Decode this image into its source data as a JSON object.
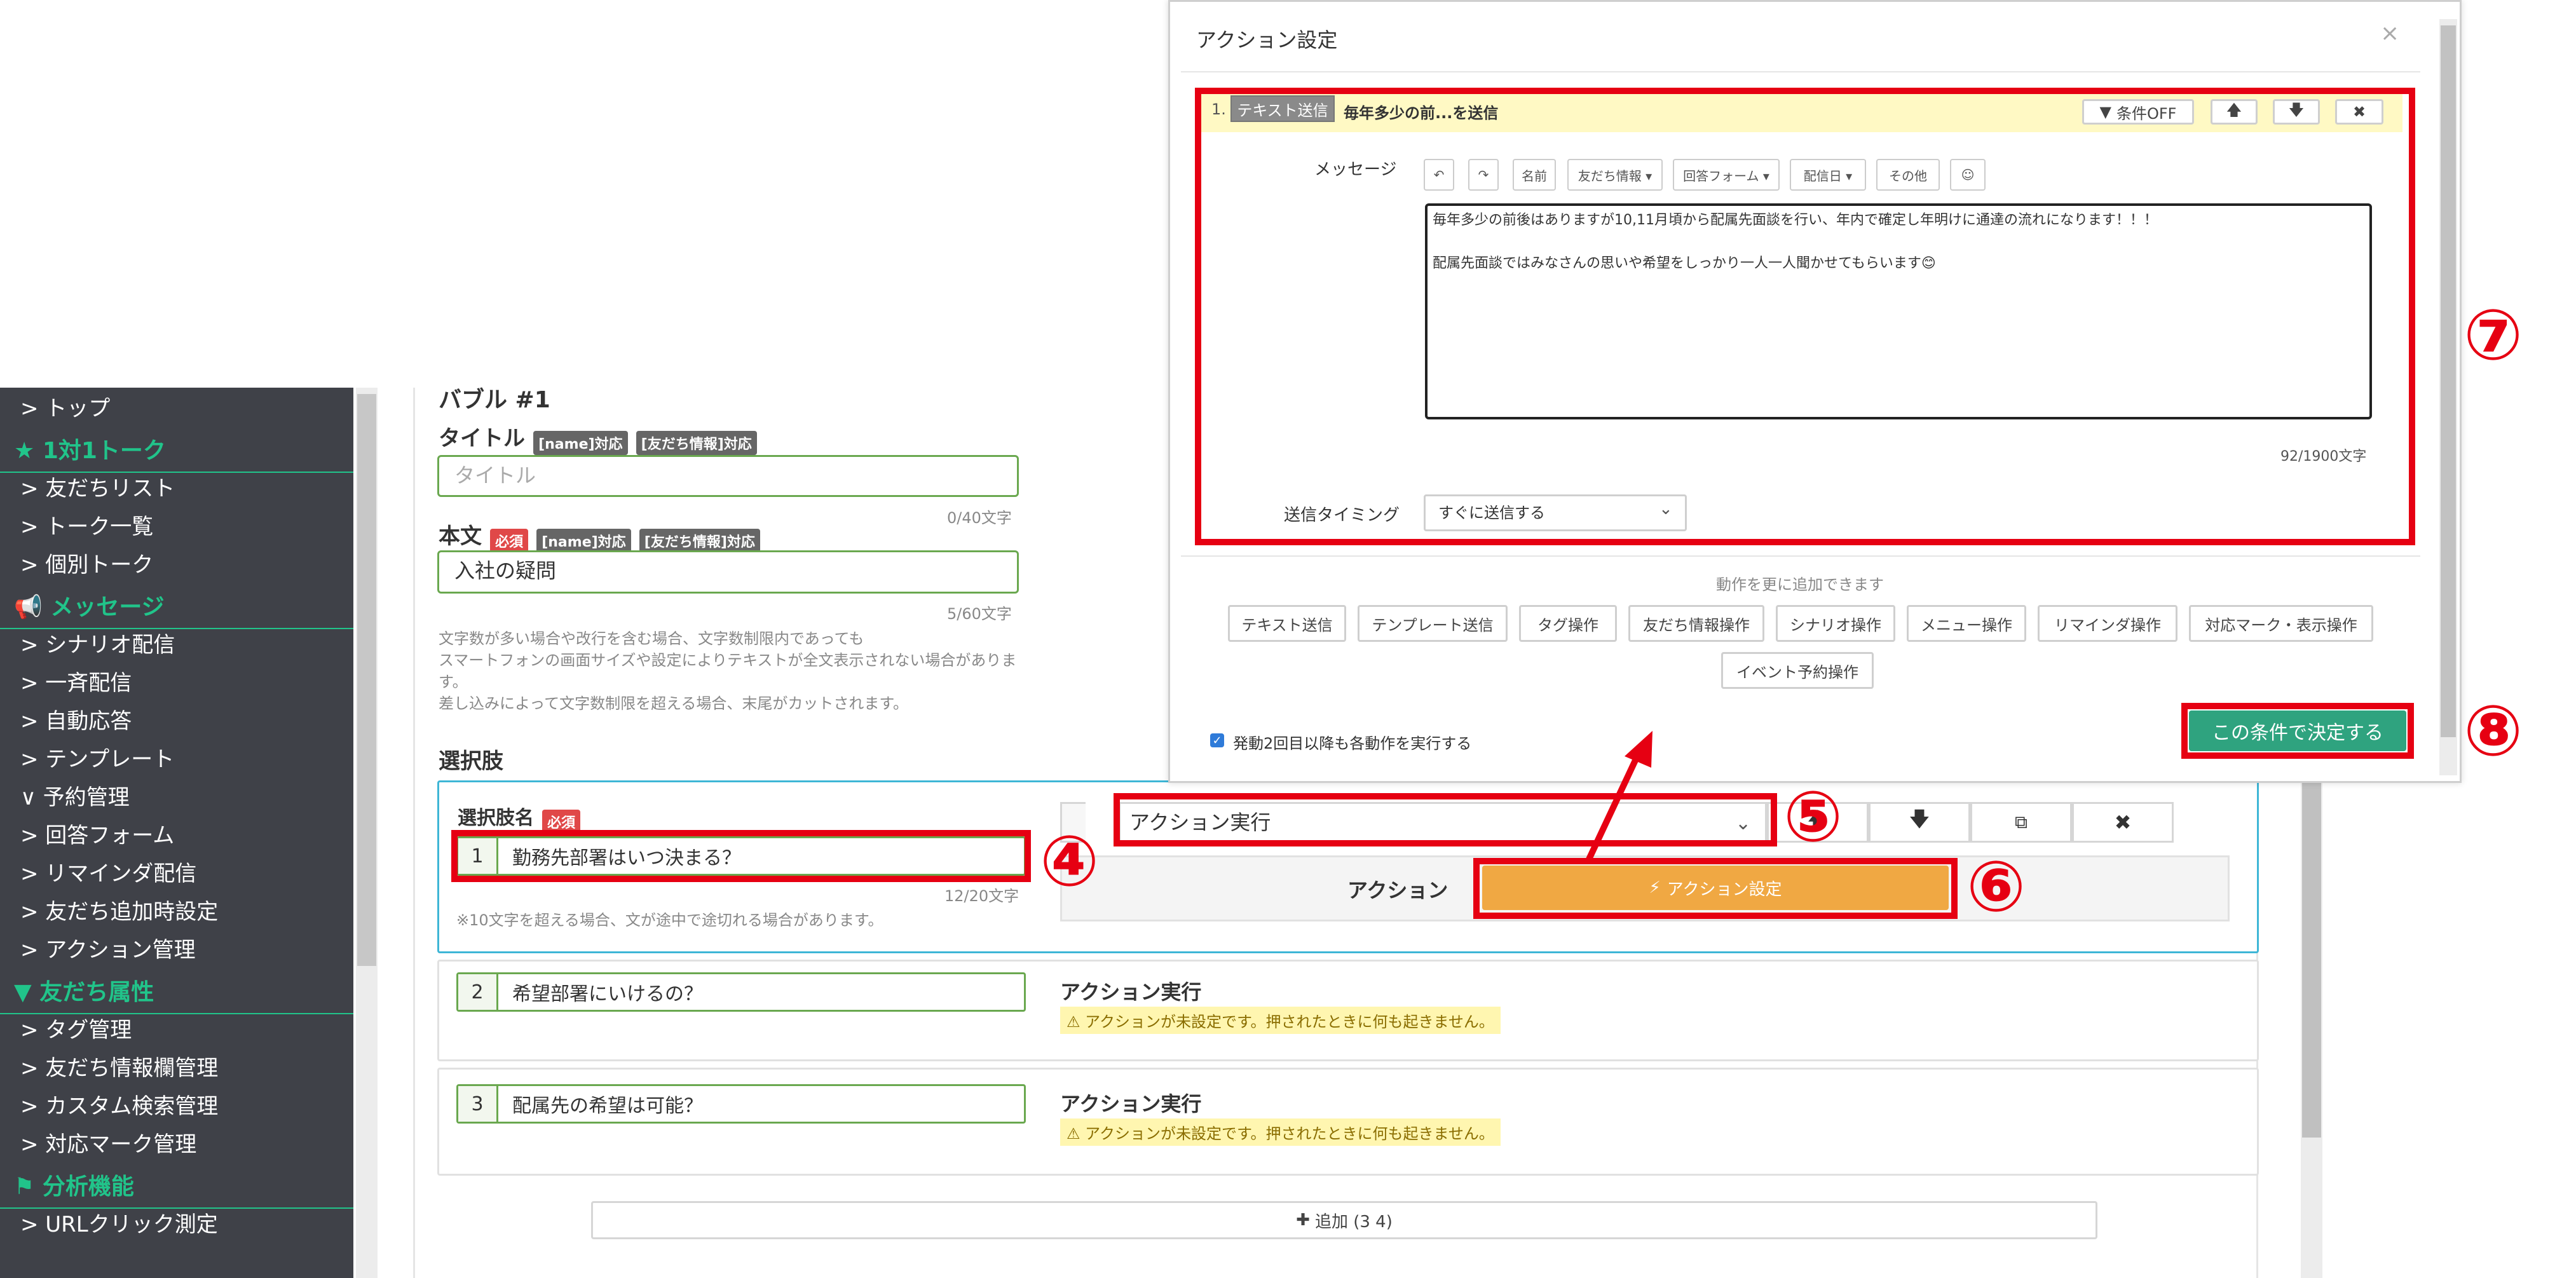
{
  "sidebar": {
    "items": [
      {
        "type": "item",
        "label": "トップ"
      },
      {
        "type": "head",
        "label": "1対1トーク",
        "icon": "star-icon"
      },
      {
        "type": "item",
        "label": "友だちリスト"
      },
      {
        "type": "item",
        "label": "トーク一覧"
      },
      {
        "type": "item",
        "label": "個別トーク"
      },
      {
        "type": "head",
        "label": "メッセージ",
        "icon": "megaphone-icon"
      },
      {
        "type": "item",
        "label": "シナリオ配信"
      },
      {
        "type": "item",
        "label": "一斉配信"
      },
      {
        "type": "item",
        "label": "自動応答"
      },
      {
        "type": "item",
        "label": "テンプレート"
      },
      {
        "type": "item",
        "label": "予約管理",
        "open": true
      },
      {
        "type": "item",
        "label": "回答フォーム"
      },
      {
        "type": "item",
        "label": "リマインダ配信"
      },
      {
        "type": "item",
        "label": "友だち追加時設定"
      },
      {
        "type": "item",
        "label": "アクション管理"
      },
      {
        "type": "head",
        "label": "友だち属性",
        "icon": "filter-icon"
      },
      {
        "type": "item",
        "label": "タグ管理"
      },
      {
        "type": "item",
        "label": "友だち情報欄管理"
      },
      {
        "type": "item",
        "label": "カスタム検索管理"
      },
      {
        "type": "item",
        "label": "対応マーク管理"
      },
      {
        "type": "head",
        "label": "分析機能",
        "icon": "flag-icon"
      },
      {
        "type": "item",
        "label": "URLクリック測定"
      }
    ]
  },
  "main": {
    "bubble_title": "バブル #1",
    "title_label": "タイトル",
    "tag_name": "[name]対応",
    "tag_friend": "[友だち情報]対応",
    "title_placeholder": "タイトル",
    "title_count": "0/40文字",
    "body_label": "本文",
    "required": "必須",
    "body_value": "入社の疑問",
    "body_count": "5/60文字",
    "help_lines": [
      "文字数が多い場合や改行を含む場合、文字数制限内であっても",
      "スマートフォンの画面サイズや設定によりテキストが全文表示されない場合があります。",
      "差し込みによって文字数制限を超える場合、末尾がカットされます。"
    ],
    "choices_label": "選択肢",
    "choice_name_label": "選択肢名",
    "choices": [
      {
        "num": "1",
        "text": "勤務先部署はいつ決まる？",
        "count": "12/20文字",
        "note": "※10文字を超える場合、文が途中で途切れる場合があります。"
      },
      {
        "num": "2",
        "text": "希望部署にいけるの？",
        "action_title": "アクション実行",
        "warning": "アクションが未設定です。押されたときに何も起きません。"
      },
      {
        "num": "3",
        "text": "配属先の希望は可能？",
        "action_title": "アクション実行",
        "warning": "アクションが未設定です。押されたときに何も起きません。"
      }
    ],
    "select_value": "アクション実行",
    "action_label": "アクション",
    "action_button": "アクション設定",
    "add_button": "追加 (3 4)"
  },
  "modal": {
    "title": "アクション設定",
    "row_number": "1.",
    "row_type": "テキスト送信",
    "row_summary": "毎年多少の前...を送信",
    "cond_off": "条件OFF",
    "message_label": "メッセージ",
    "toolbar": [
      "名前",
      "友だち情報 ▾",
      "回答フォーム ▾",
      "配信日 ▾",
      "その他"
    ],
    "message_lines": [
      "毎年多少の前後はありますが10,11月頃から配属先面談を行い、年内で確定し年明けに通達の流れになります！！！",
      "配属先面談ではみなさんの思いや希望をしっかり一人一人聞かせてもらいます😊"
    ],
    "char_count": "92/1900文字",
    "timing_label": "送信タイミング",
    "timing_value": "すぐに送信する",
    "add_hint": "動作を更に追加できます",
    "actions_row1": [
      "テキスト送信",
      "テンプレート送信",
      "タグ操作",
      "友だち情報操作",
      "シナリオ操作",
      "メニュー操作",
      "リマインダ操作",
      "対応マーク・表示操作"
    ],
    "actions_row2": [
      "イベント予約操作"
    ],
    "repeat_label": "発動2回目以降も各動作を実行する",
    "submit": "この条件で決定する"
  },
  "annotations": [
    "④",
    "⑤",
    "⑥",
    "⑦",
    "⑧"
  ],
  "colors": {
    "accent_green": "#21c48a",
    "highlight_red": "#e60012",
    "action_orange": "#f0a843",
    "submit_teal": "#2fa37f"
  }
}
